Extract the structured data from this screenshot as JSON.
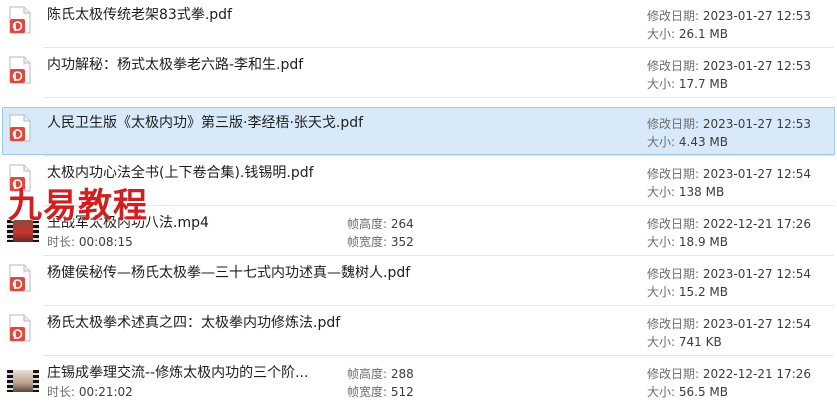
{
  "labels": {
    "modified": "修改日期:",
    "size": "大小:",
    "duration": "时长:",
    "frame_height": "帧高度:",
    "frame_width": "帧宽度:"
  },
  "watermark": "九易教程",
  "files": [
    {
      "name": "陈氏太极传统老架83式拳.pdf",
      "modified": "2023-01-27 12:53",
      "size": "26.1 MB",
      "type": "pdf-icon"
    },
    {
      "name": "内功解秘：杨式太极拳老六路-李和生.pdf",
      "modified": "2023-01-27 12:53",
      "size": "17.7 MB",
      "type": "pdf-icon"
    },
    {
      "name": "人民卫生版《太极内功》第三版·李经梧·张天戈.pdf",
      "modified": "2023-01-27 12:53",
      "size": "4.43 MB",
      "type": "pdf-icon",
      "selected": true
    },
    {
      "name": "太极内功心法全书(上下卷合集).钱锡明.pdf",
      "modified": "2023-01-27 12:54",
      "size": "138 MB",
      "type": "pdf-icon"
    },
    {
      "name": "王战军太极内功八法.mp4",
      "modified": "2022-12-21 17:26",
      "size": "18.9 MB",
      "type": "video-thumbnail",
      "duration": "00:08:15",
      "frame_height": "264",
      "frame_width": "352"
    },
    {
      "name": "杨健侯秘传—杨氏太极拳—三十七式内功述真—魏树人.pdf",
      "modified": "2023-01-27 12:54",
      "size": "15.2 MB",
      "type": "pdf-icon"
    },
    {
      "name": "杨氏太极拳术述真之四：太极拳内功修炼法.pdf",
      "modified": "2023-01-27 12:54",
      "size": "741 KB",
      "type": "pdf-icon"
    },
    {
      "name": "庄锡成拳理交流--修炼太极内功的三个阶...",
      "modified": "2022-12-21 17:26",
      "size": "56.5 MB",
      "type": "video-thumbnail",
      "duration": "00:21:02",
      "frame_height": "288",
      "frame_width": "512"
    }
  ]
}
